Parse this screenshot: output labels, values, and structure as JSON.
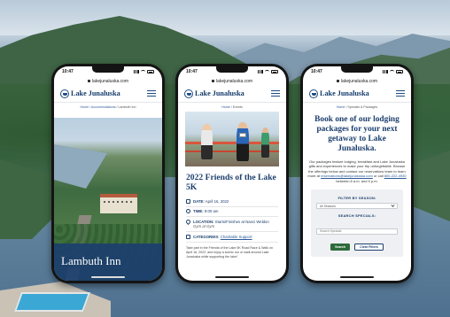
{
  "phones": [
    {
      "status_time": "10:47",
      "url": "lakejunaluska.com",
      "logo_text": "Lake Junaluska",
      "breadcrumb": {
        "home": "Home",
        "middle": "Accommodations",
        "current": "Lambuth Inn"
      },
      "hero_title": "Lambuth Inn"
    },
    {
      "status_time": "10:47",
      "url": "lakejunaluska.com",
      "logo_text": "Lake Junaluska",
      "breadcrumb": {
        "home": "Home",
        "current": "Events"
      },
      "event_title": "2022 Friends of the Lake 5K",
      "meta": {
        "date_label": "DATE:",
        "date_value": "April 16, 2022",
        "time_label": "TIME:",
        "time_value": "9:00 am",
        "location_label": "LOCATION:",
        "location_value": "Starts/Finishes at Nanci Weldon",
        "location_sub": "Gym at Gym",
        "categories_label": "CATEGORIES:",
        "categories_value": "Charitable Support"
      },
      "body": "Take part in the Friends of the Lake 5K Road Race & Walk on April 16, 2022, and enjoy a scenic run or walk around Lake Junaluska while supporting the lake!"
    },
    {
      "status_time": "10:47",
      "url": "lakejunaluska.com",
      "logo_text": "Lake Junaluska",
      "breadcrumb": {
        "home": "Home",
        "current": "Specials & Packages"
      },
      "title": "Book one of our lodging packages for your next getaway to Lake Junaluska.",
      "body_pre": "Our packages feature lodging, breakfast and Lake Junaluska gifts and experiences to make your trip unforgettable. Browse the offerings below and contact our reservations team to learn more at ",
      "body_link": "reservations@lakejunaluska.com",
      "body_mid": " or call ",
      "body_phone": "800-222-4930",
      "body_post": " between 8 a.m. and 5 p.m.",
      "filter_season_label": "FILTER BY SEASON:",
      "filter_season_value": "All Seasons",
      "search_label": "SEARCH SPECIALS:",
      "search_placeholder": "Search Specials",
      "search_button": "Search",
      "clear_button": "Clear Filters"
    }
  ],
  "colors": {
    "navy": "#1c3f6e",
    "link": "#2c5b99",
    "green_button": "#2e6b3b"
  }
}
